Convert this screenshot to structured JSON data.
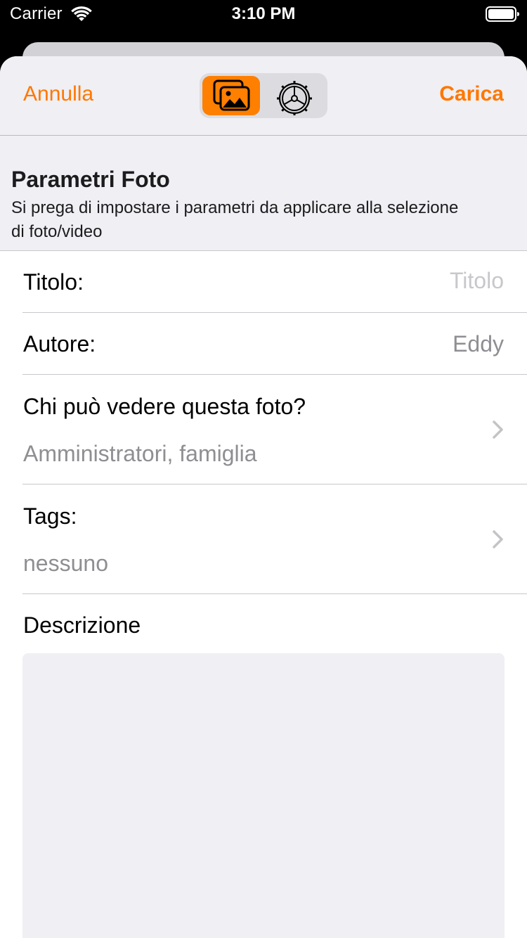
{
  "status_bar": {
    "carrier": "Carrier",
    "time": "3:10 PM",
    "icons": [
      "wifi-icon",
      "battery-icon"
    ]
  },
  "navbar": {
    "cancel_label": "Annulla",
    "upload_label": "Carica",
    "segments": [
      {
        "icon": "photos-icon",
        "selected": true
      },
      {
        "icon": "gear-icon",
        "selected": false
      }
    ],
    "accent_color": "#ff7700"
  },
  "section": {
    "title": "Parametri Foto",
    "subtitle": "Si prega di impostare i parametri da applicare alla selezione di foto/video"
  },
  "fields": {
    "title": {
      "label": "Titolo:",
      "value": "",
      "placeholder": "Titolo"
    },
    "author": {
      "label": "Autore:",
      "value": "Eddy"
    },
    "privacy": {
      "label": "Chi può vedere questa foto?",
      "value": "Amministratori, famiglia"
    },
    "tags": {
      "label": "Tags:",
      "value": "nessuno"
    },
    "description": {
      "label": "Descrizione",
      "value": ""
    }
  }
}
